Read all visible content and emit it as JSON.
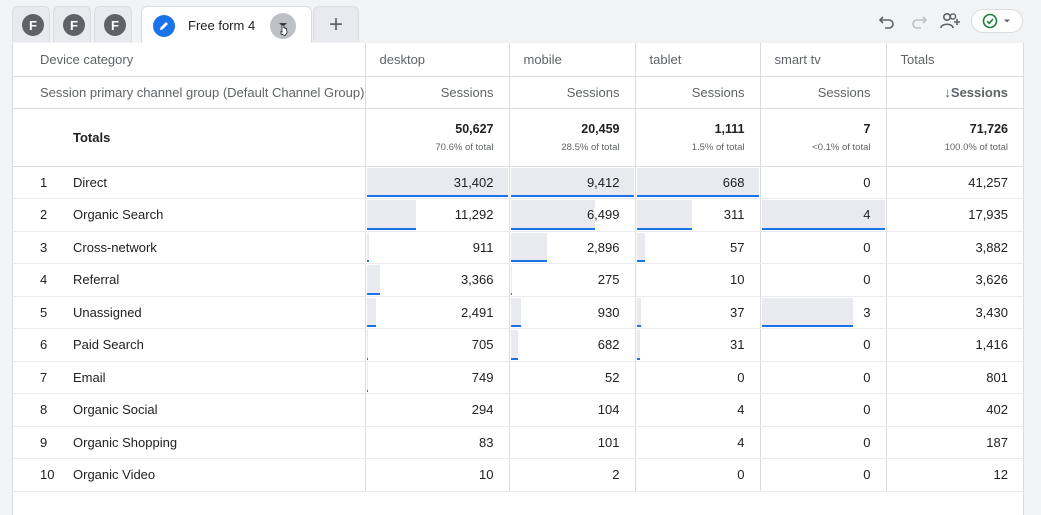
{
  "tabs": {
    "collapsed": [
      "F",
      "F",
      "F"
    ],
    "active_label": "Free form 4",
    "add_symbol": "+"
  },
  "toolbar": {
    "icons": [
      "undo-icon",
      "redo-icon",
      "share-user-icon",
      "check-circle-icon",
      "dropdown-arrow-icon"
    ]
  },
  "table": {
    "dimension_header": "Device category",
    "row_dimension_header": "Session primary channel group (Default Channel Group)",
    "columns": [
      "desktop",
      "mobile",
      "tablet",
      "smart tv",
      "Totals"
    ],
    "metric_label": "Sessions",
    "sorted_metric_label": "Sessions",
    "sort_arrow": "↓",
    "totals_label": "Totals",
    "totals": [
      "50,627",
      "20,459",
      "1,111",
      "7",
      "71,726"
    ],
    "totals_pct": [
      "70.6% of total",
      "28.5% of total",
      "1.5% of total",
      "<0.1% of total",
      "100.0% of total"
    ],
    "rows": [
      {
        "rank": "1",
        "name": "Direct",
        "values": [
          "31,402",
          "9,412",
          "668",
          "0",
          "41,257"
        ]
      },
      {
        "rank": "2",
        "name": "Organic Search",
        "values": [
          "11,292",
          "6,499",
          "311",
          "4",
          "17,935"
        ]
      },
      {
        "rank": "3",
        "name": "Cross-network",
        "values": [
          "911",
          "2,896",
          "57",
          "0",
          "3,882"
        ]
      },
      {
        "rank": "4",
        "name": "Referral",
        "values": [
          "3,366",
          "275",
          "10",
          "0",
          "3,626"
        ]
      },
      {
        "rank": "5",
        "name": "Unassigned",
        "values": [
          "2,491",
          "930",
          "37",
          "3",
          "3,430"
        ]
      },
      {
        "rank": "6",
        "name": "Paid Search",
        "values": [
          "705",
          "682",
          "31",
          "0",
          "1,416"
        ]
      },
      {
        "rank": "7",
        "name": "Email",
        "values": [
          "749",
          "52",
          "0",
          "0",
          "801"
        ]
      },
      {
        "rank": "8",
        "name": "Organic Social",
        "values": [
          "294",
          "104",
          "4",
          "0",
          "402"
        ]
      },
      {
        "rank": "9",
        "name": "Organic Shopping",
        "values": [
          "83",
          "101",
          "4",
          "0",
          "187"
        ]
      },
      {
        "rank": "10",
        "name": "Organic Video",
        "values": [
          "10",
          "2",
          "0",
          "0",
          "12"
        ]
      }
    ]
  },
  "colors": {
    "accent": "#1a73e8",
    "bar_fill": "#e8eaed",
    "success": "#188038"
  }
}
